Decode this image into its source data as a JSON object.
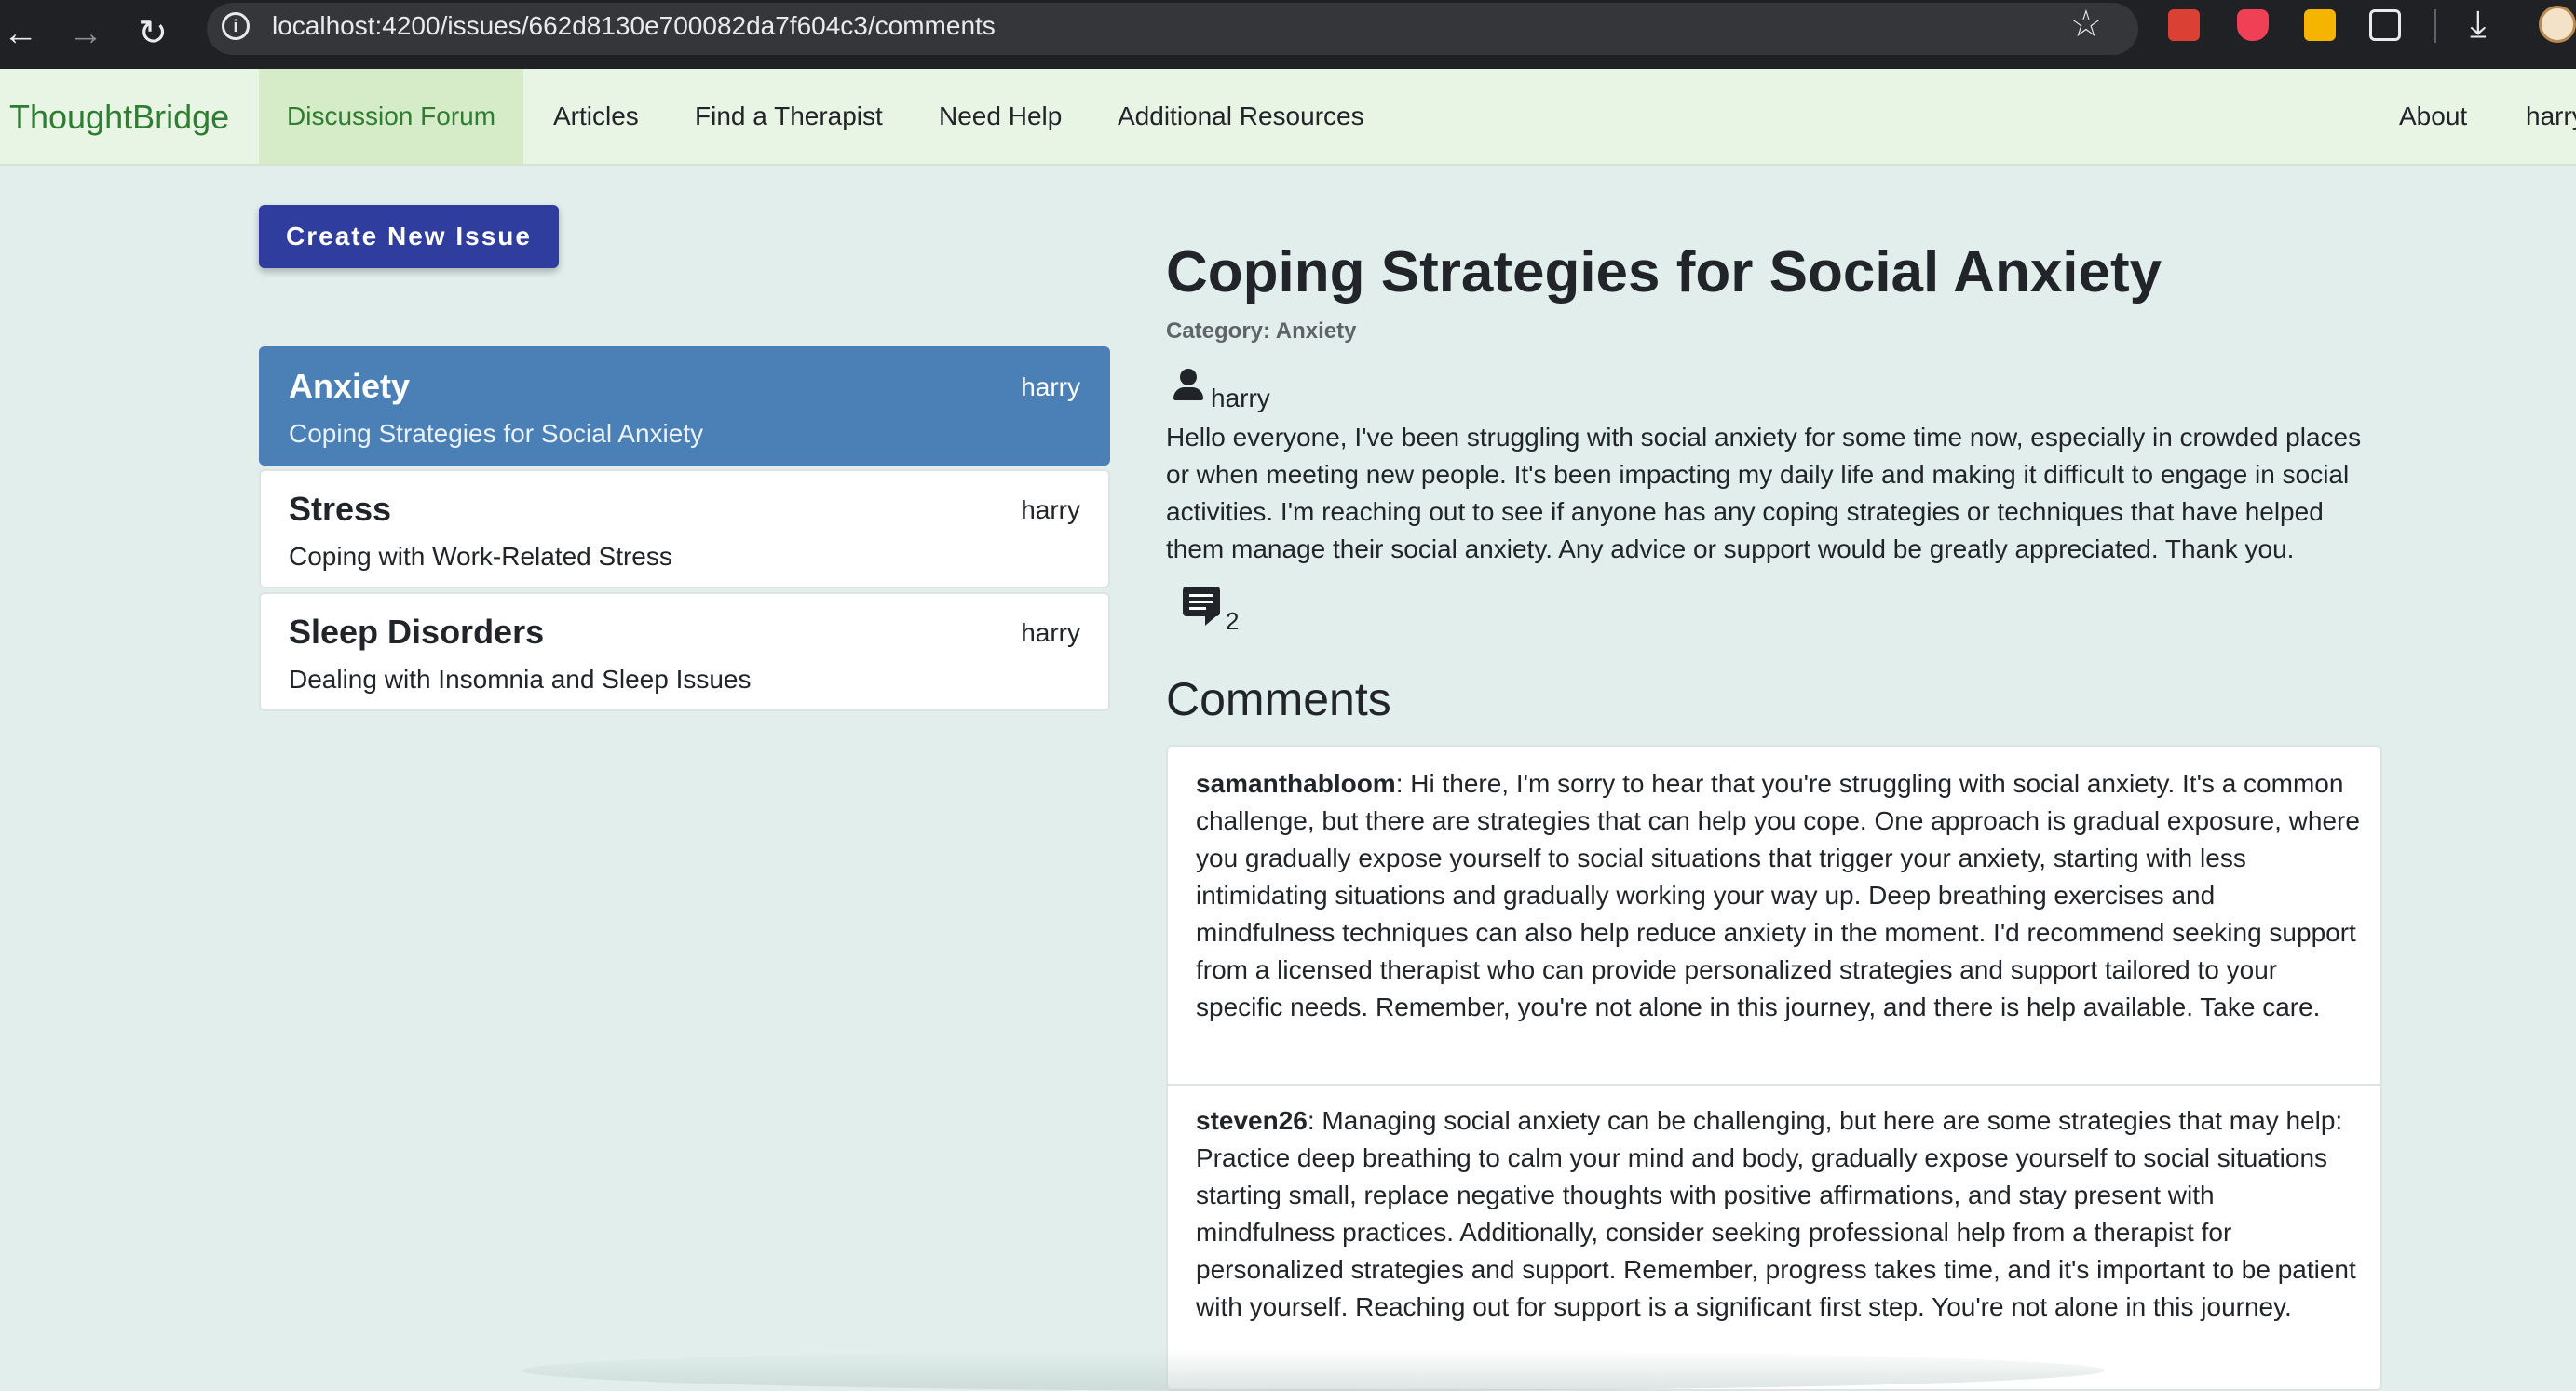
{
  "browser": {
    "url": "localhost:4200/issues/662d8130e700082da7f604c3/comments",
    "icons": [
      "back-icon",
      "forward-icon",
      "reload-icon",
      "info-icon",
      "star-icon",
      "todoist-extension-icon",
      "pocket-extension-icon",
      "keep-extension-icon",
      "extensions-icon",
      "download-icon",
      "profile-avatar"
    ]
  },
  "navbar": {
    "brand": "ThoughtBridge",
    "items": [
      "Discussion Forum",
      "Articles",
      "Find a Therapist",
      "Need Help",
      "Additional Resources"
    ],
    "right_items": [
      "About",
      "harry"
    ],
    "active_index": 0
  },
  "create_button": "Create New Issue",
  "issues": [
    {
      "category": "Anxiety",
      "user": "harry",
      "title": "Coping Strategies for Social Anxiety",
      "active": true
    },
    {
      "category": "Stress",
      "user": "harry",
      "title": "Coping with Work-Related Stress",
      "active": false
    },
    {
      "category": "Sleep Disorders",
      "user": "harry",
      "title": "Dealing with Insomnia and Sleep Issues",
      "active": false
    }
  ],
  "post": {
    "title": "Coping Strategies for Social Anxiety",
    "category": "Category: Anxiety",
    "user": "harry",
    "body": "Hello everyone, I've been struggling with social anxiety for some time now, especially in crowded places or when meeting new people. It's been impacting my daily life and making it difficult to engage in social activities. I'm reaching out to see if anyone has any coping strategies or techniques that have helped them manage their social anxiety. Any advice or support would be greatly appreciated. Thank you.",
    "comment_count": "2"
  },
  "comments_heading": "Comments",
  "comments": [
    {
      "user": "samanthabloom",
      "text": ": Hi there, I'm sorry to hear that you're struggling with social anxiety. It's a common challenge, but there are strategies that can help you cope. One approach is gradual exposure, where you gradually expose yourself to social situations that trigger your anxiety, starting with less intimidating situations and gradually working your way up. Deep breathing exercises and mindfulness techniques can also help reduce anxiety in the moment. I'd recommend seeking support from a licensed therapist who can provide personalized strategies and support tailored to your specific needs. Remember, you're not alone in this journey, and there is help available. Take care."
    },
    {
      "user": "steven26",
      "text": ": Managing social anxiety can be challenging, but here are some strategies that may help: Practice deep breathing to calm your mind and body, gradually expose yourself to social situations starting small, replace negative thoughts with positive affirmations, and stay present with mindfulness practices. Additionally, consider seeking professional help from a therapist for personalized strategies and support. Remember, progress takes time, and it's important to be patient with yourself. Reaching out for support is a significant first step. You're not alone in this journey."
    }
  ]
}
